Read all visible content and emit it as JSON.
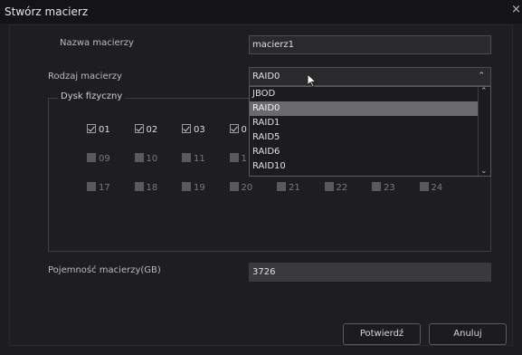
{
  "dialog": {
    "title": "Stwórz macierz",
    "close_glyph": "×"
  },
  "form": {
    "name_label": "Nazwa macierzy",
    "name_value": "macierz1",
    "type_label": "Rodzaj macierzy",
    "type_value": "RAID0",
    "capacity_label": "Pojemność macierzy(GB)",
    "capacity_value": "3726"
  },
  "disks": {
    "legend": "Dysk fizyczny",
    "row1": [
      {
        "label": "01",
        "checked": true
      },
      {
        "label": "02",
        "checked": true
      },
      {
        "label": "03",
        "checked": true
      },
      {
        "label": "0",
        "checked": true
      }
    ],
    "row2": [
      {
        "label": "09",
        "checked": false
      },
      {
        "label": "10",
        "checked": false
      },
      {
        "label": "11",
        "checked": false
      },
      {
        "label": "1",
        "checked": false
      }
    ],
    "row3": [
      {
        "label": "17",
        "checked": false
      },
      {
        "label": "18",
        "checked": false
      },
      {
        "label": "19",
        "checked": false
      },
      {
        "label": "20",
        "checked": false
      },
      {
        "label": "21",
        "checked": false
      },
      {
        "label": "22",
        "checked": false
      },
      {
        "label": "23",
        "checked": false
      },
      {
        "label": "24",
        "checked": false
      }
    ]
  },
  "dropdown": {
    "options": [
      "JBOD",
      "RAID0",
      "RAID1",
      "RAID5",
      "RAID6",
      "RAID10"
    ],
    "selected_index": 1
  },
  "buttons": {
    "confirm": "Potwierdź",
    "cancel": "Anuluj"
  },
  "icons": {
    "chevron_up": "chevron-up-icon",
    "chevron_down": "chevron-down-icon",
    "cursor": "mouse-pointer-icon"
  }
}
